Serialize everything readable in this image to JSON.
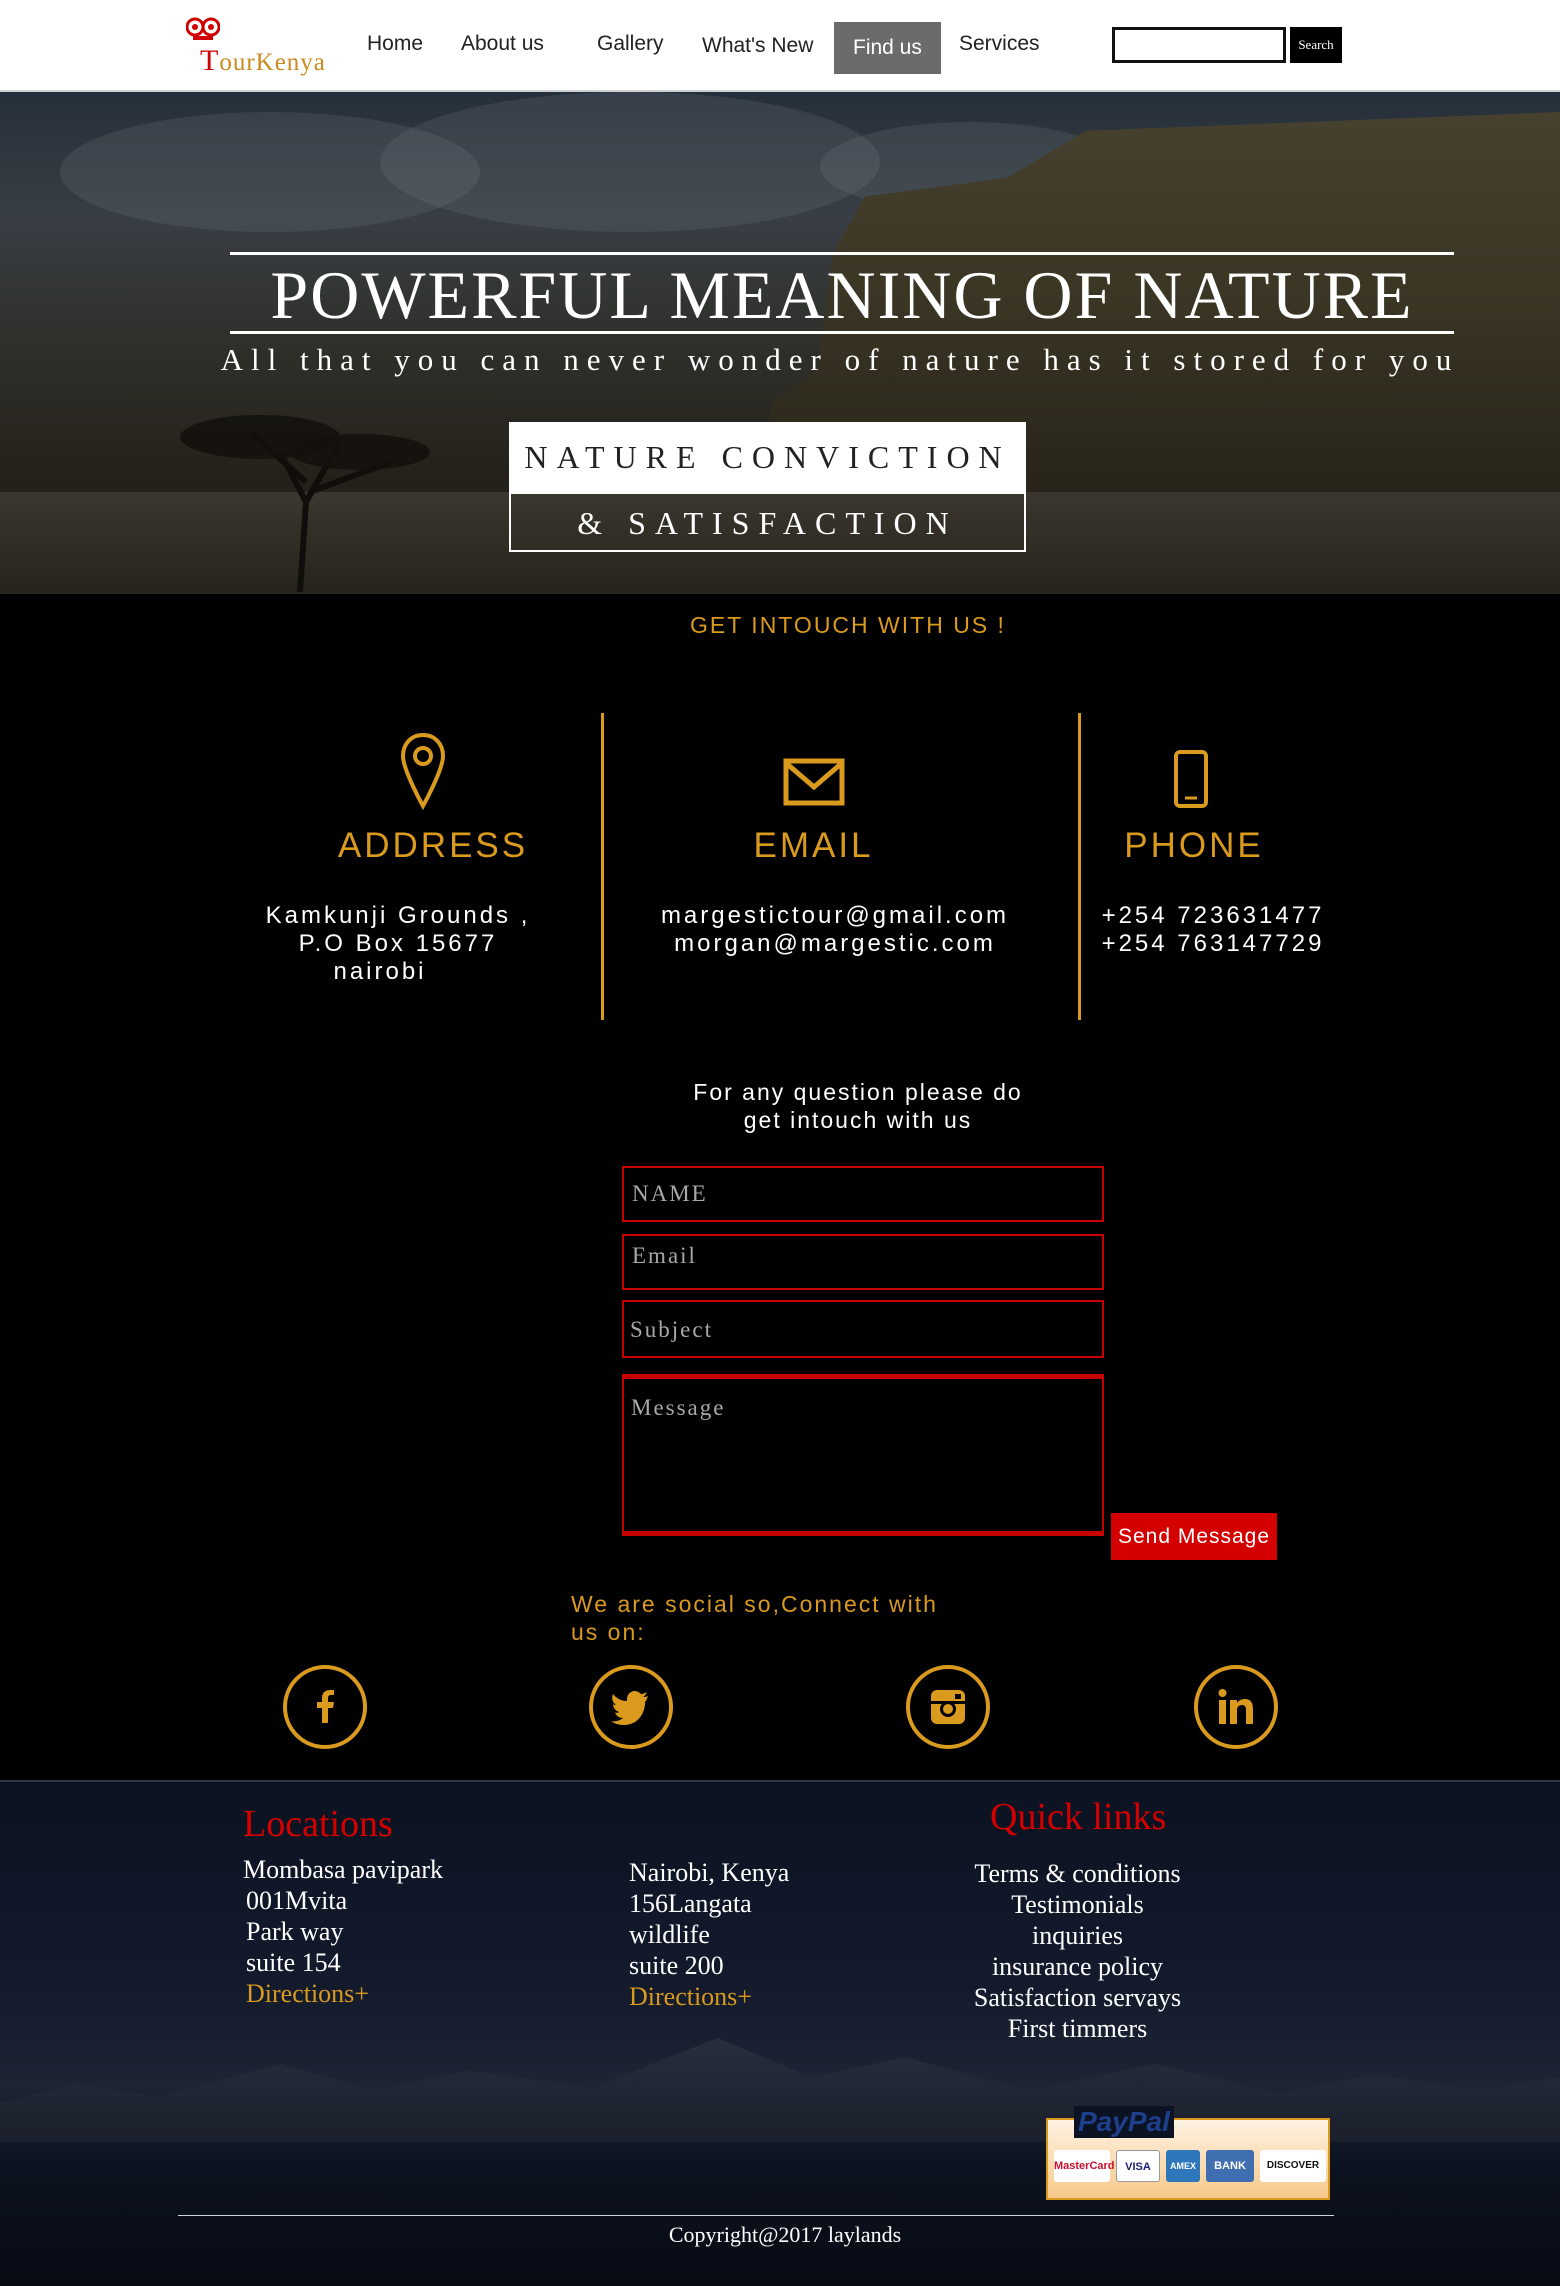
{
  "header": {
    "logo_text_initial": "T",
    "logo_text": "ourKenya",
    "nav": [
      "Home",
      "About us",
      "Gallery",
      "What's New",
      "Find us",
      "Services"
    ],
    "active_nav": "Find us",
    "search_value": "",
    "search_button": "Search"
  },
  "hero": {
    "title": "POWERFUL MEANING OF NATURE",
    "subtitle": "All that you can never wonder of nature has it stored for you",
    "button_top": "NATURE CONVICTION",
    "button_bottom": "& SATISFACTION"
  },
  "contact": {
    "heading": "GET INTOUCH WITH US !",
    "address_title": "ADDRESS",
    "address_lines": [
      "Kamkunji Grounds ,",
      "P.O Box 15677",
      "nairobi"
    ],
    "email_title": "EMAIL",
    "email_lines": [
      "margestictour@gmail.com",
      "morgan@margestic.com"
    ],
    "phone_title": "PHONE",
    "phone_lines": [
      "+254 723631477",
      "+254 763147729"
    ],
    "question": [
      "For any question please do",
      "get intouch with us"
    ]
  },
  "form": {
    "name_placeholder": "NAME",
    "email_placeholder": "Email",
    "subject_placeholder": "Subject",
    "message_placeholder": "Message",
    "send_label": "Send Message"
  },
  "social": {
    "text": [
      "We are social so,Connect with",
      "us on:"
    ],
    "icons": [
      "facebook-icon",
      "twitter-icon",
      "instagram-icon",
      "linkedin-icon"
    ]
  },
  "footer": {
    "locations_title": "Locations",
    "loc1": [
      "Mombasa pavipark",
      "001Mvita",
      "Park way",
      "suite 154"
    ],
    "loc2": [
      "Nairobi, Kenya",
      "156Langata",
      "wildlife",
      "suite 200"
    ],
    "directions": "Directions+",
    "quick_title": "Quick links",
    "quick_links": [
      "Terms & conditions",
      "Testimonials",
      "inquiries",
      "insurance policy",
      "Satisfaction servays",
      "First timmers"
    ],
    "paypal": "PayPal",
    "cards": [
      "MasterCard",
      "VISA",
      "AMEX",
      "BANK",
      "DISCOVER"
    ],
    "copyright": "Copyright@2017 laylands"
  },
  "colors": {
    "accent": "#d99a1e",
    "brand_red": "#d40000",
    "nav_active": "#6b6b6b"
  }
}
